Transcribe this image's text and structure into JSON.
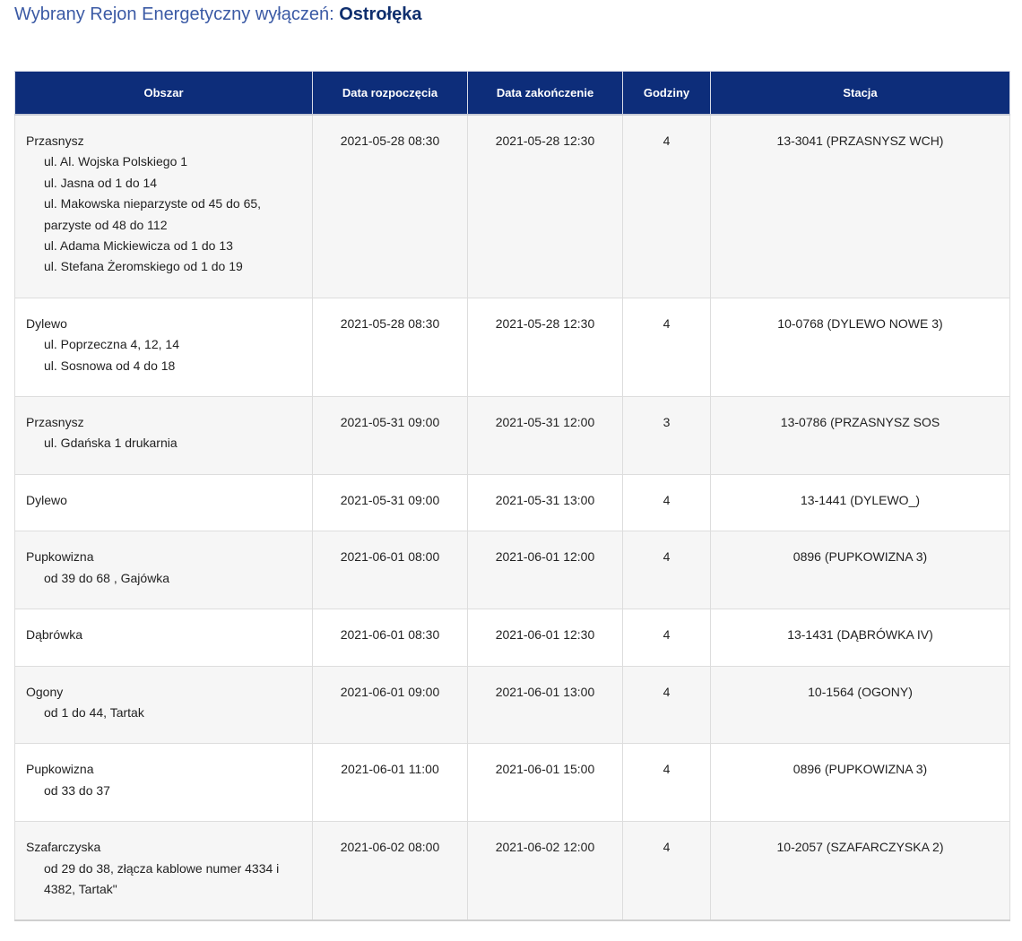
{
  "header": {
    "label": "Wybrany Rejon Energetyczny wyłączeń:",
    "region": "Ostrołęka"
  },
  "table": {
    "columns": [
      "Obszar",
      "Data rozpoczęcia",
      "Data zakończenie",
      "Godziny",
      "Stacja"
    ],
    "rows": [
      {
        "area": "Przasnysz",
        "streets": [
          "ul. Al. Wojska Polskiego 1",
          "ul. Jasna od 1 do 14",
          "ul. Makowska nieparzyste od 45 do 65, parzyste od 48 do 112",
          "ul. Adama Mickiewicza od 1 do 13",
          "ul. Stefana Żeromskiego od 1 do 19"
        ],
        "start": "2021-05-28 08:30",
        "end": "2021-05-28 12:30",
        "hours": "4",
        "station": "13-3041 (PRZASNYSZ WCH)"
      },
      {
        "area": "Dylewo",
        "streets": [
          "ul. Poprzeczna 4, 12, 14",
          "ul. Sosnowa od 4 do 18"
        ],
        "start": "2021-05-28 08:30",
        "end": "2021-05-28 12:30",
        "hours": "4",
        "station": "10-0768 (DYLEWO NOWE 3)"
      },
      {
        "area": "Przasnysz",
        "streets": [
          "ul. Gdańska 1 drukarnia"
        ],
        "start": "2021-05-31 09:00",
        "end": "2021-05-31 12:00",
        "hours": "3",
        "station": "13-0786 (PRZASNYSZ SOS"
      },
      {
        "area": "Dylewo",
        "streets": [],
        "start": "2021-05-31 09:00",
        "end": "2021-05-31 13:00",
        "hours": "4",
        "station": "13-1441 (DYLEWO_)"
      },
      {
        "area": "Pupkowizna",
        "streets": [
          "od 39 do 68 , Gajówka"
        ],
        "start": "2021-06-01 08:00",
        "end": "2021-06-01 12:00",
        "hours": "4",
        "station": "0896 (PUPKOWIZNA 3)"
      },
      {
        "area": "Dąbrówka",
        "streets": [],
        "start": "2021-06-01 08:30",
        "end": "2021-06-01 12:30",
        "hours": "4",
        "station": "13-1431 (DĄBRÓWKA IV)"
      },
      {
        "area": "Ogony",
        "streets": [
          "od 1 do 44, Tartak"
        ],
        "start": "2021-06-01 09:00",
        "end": "2021-06-01 13:00",
        "hours": "4",
        "station": "10-1564 (OGONY)"
      },
      {
        "area": "Pupkowizna",
        "streets": [
          "od 33 do 37"
        ],
        "start": "2021-06-01 11:00",
        "end": "2021-06-01 15:00",
        "hours": "4",
        "station": "0896 (PUPKOWIZNA 3)"
      },
      {
        "area": "Szafarczyska",
        "streets": [
          "od 29 do 38, złącza kablowe numer 4334 i 4382, Tartak\""
        ],
        "start": "2021-06-02 08:00",
        "end": "2021-06-02 12:00",
        "hours": "4",
        "station": "10-2057 (SZAFARCZYSKA 2)"
      }
    ]
  }
}
